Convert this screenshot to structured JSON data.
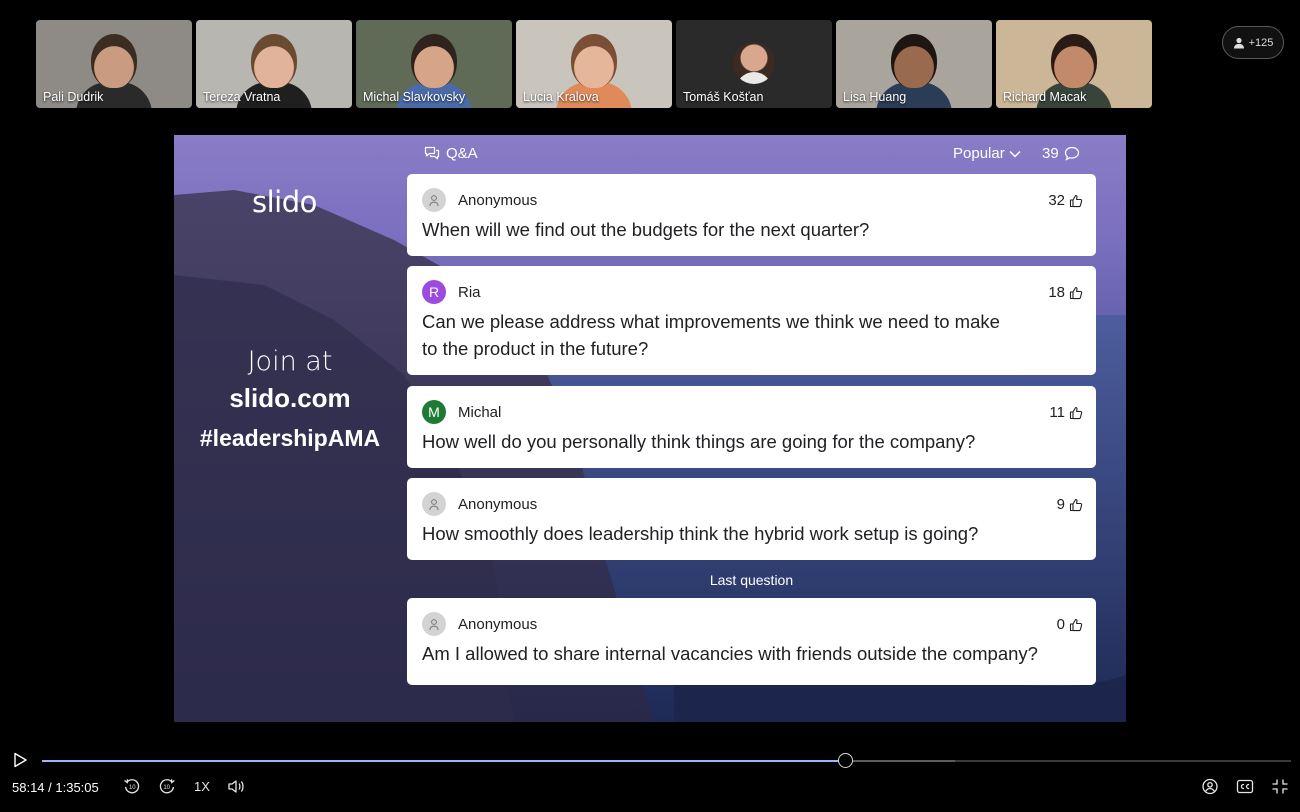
{
  "participants": [
    {
      "name": "Pali Dudrik",
      "bg": "#8e8b86",
      "skin": "#c99b80",
      "hair": "#3c2c22",
      "shirt": "#2a2a2a"
    },
    {
      "name": "Tereza Vratna",
      "bg": "#b7b6b1",
      "skin": "#e1b39a",
      "hair": "#6b4a32",
      "shirt": "#1f1f1f"
    },
    {
      "name": "Michal Slavkovsky",
      "bg": "#5f6b57",
      "skin": "#d6a487",
      "hair": "#2e241d",
      "shirt": "#4a6aa8"
    },
    {
      "name": "Lucia Kralova",
      "bg": "#c9c5bd",
      "skin": "#e6b69a",
      "hair": "#7a4f35",
      "shirt": "#e08a5a"
    },
    {
      "name": "Tomáš Košťan",
      "bg": "#2a2a2a",
      "avatar": true
    },
    {
      "name": "Lisa Huang",
      "bg": "#a9a59c",
      "skin": "#9a6a4e",
      "hair": "#1e1612",
      "shirt": "#2b3d56"
    },
    {
      "name": "Richard Macak",
      "bg": "#cbb797",
      "skin": "#c28a6a",
      "hair": "#2a1c15",
      "shirt": "#38443a"
    }
  ],
  "more_participants": "+125",
  "slide": {
    "brand": "slido",
    "join_line1": "Join at",
    "join_line2": "slido.com",
    "join_line3": "#leadershipAMA",
    "qa_label": "Q&A",
    "sort_label": "Popular",
    "question_count": "39",
    "last_question_label": "Last question",
    "questions": [
      {
        "author": "Anonymous",
        "initial": "",
        "avatar_color": "#d3d3d3",
        "text_lines": [
          "When will we find out the budgets for the next quarter?"
        ],
        "likes": "32"
      },
      {
        "author": "Ria",
        "initial": "R",
        "avatar_color": "#9b4be0",
        "text_lines": [
          "Can we please address what improvements we think we need to make",
          "to the product in the future?"
        ],
        "likes": "18"
      },
      {
        "author": "Michal",
        "initial": "M",
        "avatar_color": "#1f7a34",
        "text_lines": [
          "How well do you personally think things are going for the company?"
        ],
        "likes": "11"
      },
      {
        "author": "Anonymous",
        "initial": "",
        "avatar_color": "#d3d3d3",
        "text_lines": [
          "How smoothly does leadership think the hybrid work setup is going?"
        ],
        "likes": "9"
      },
      {
        "author": "Anonymous",
        "initial": "",
        "avatar_color": "#d3d3d3",
        "text_lines": [
          "Am I allowed to share internal vacancies with friends outside the company?"
        ],
        "likes": "0"
      }
    ]
  },
  "player": {
    "time": "58:14 / 1:35:05",
    "progress": 0.6434,
    "buffered": 0.7306,
    "rewind_label": "10",
    "forward_label": "10",
    "speed": "1X",
    "accent": "#9db4ff"
  }
}
